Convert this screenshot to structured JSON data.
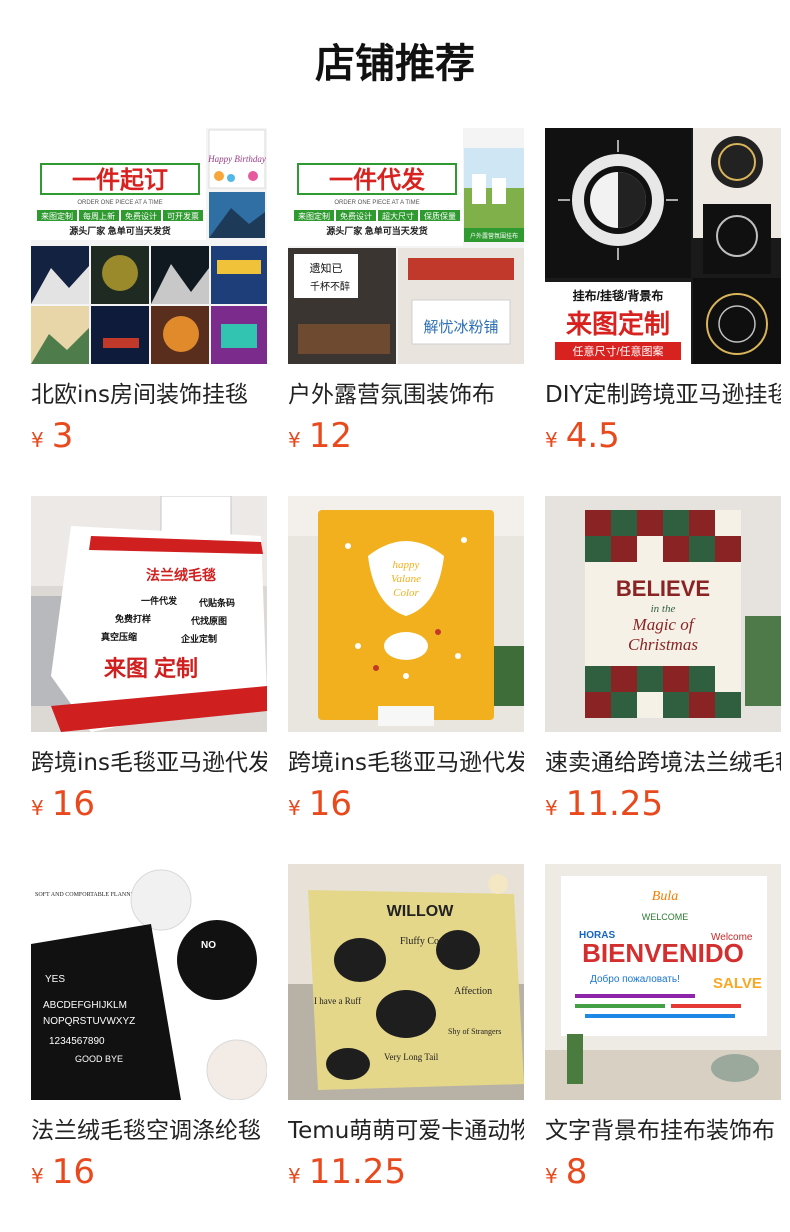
{
  "header": {
    "title": "店铺推荐"
  },
  "products": [
    {
      "name": "北欧ins房间装饰挂毯",
      "currency": "¥",
      "price": "3",
      "image": {
        "headline": "一件起订",
        "subline": "ORDER ONE PIECE AT A TIME",
        "tags": [
          "来图定制",
          "每周上新",
          "免费设计",
          "可开发票"
        ],
        "note": "源头厂家 急单可当天发货",
        "badge": "Happy Birthday"
      }
    },
    {
      "name": "户外露营氛围装饰布",
      "currency": "¥",
      "price": "12",
      "image": {
        "headline": "一件代发",
        "subline": "ORDER ONE PIECE AT A TIME",
        "tags": [
          "来图定制",
          "免费设计",
          "超大尺寸",
          "保质保量"
        ],
        "note": "源头厂家 急单可当天发货",
        "sign1": "遗知已",
        "sign2": "千杯不醉",
        "sign3": "解忧冰粉铺",
        "corner": "户外露营氛围挂布"
      }
    },
    {
      "name": "DIY定制跨境亚马逊挂毯",
      "currency": "¥",
      "price": "4.5",
      "image": {
        "line1": "挂布/挂毯/背景布",
        "line2": "来图定制",
        "line3": "任意尺寸/任意图案"
      }
    },
    {
      "name": "跨境ins毛毯亚马逊代发",
      "currency": "¥",
      "price": "16",
      "image": {
        "headline": "法兰绒毛毯",
        "features": [
          "一件代发",
          "代贴条码",
          "免费打样",
          "代找原图",
          "真空压缩",
          "企业定制"
        ],
        "cta": "来图 定制"
      }
    },
    {
      "name": "跨境ins毛毯亚马逊代发",
      "currency": "¥",
      "price": "16",
      "image": {
        "center1": "happy",
        "center2": "Valane",
        "center3": "Color"
      }
    },
    {
      "name": "速卖通给跨境法兰绒毛毯",
      "currency": "¥",
      "price": "11.25",
      "image": {
        "line1": "BELIEVE",
        "line2": "in the",
        "line3": "Magic of",
        "line4": "Christmas"
      }
    },
    {
      "name": "法兰绒毛毯空调涤纶毯",
      "currency": "¥",
      "price": "16",
      "image": {
        "top": "SOFT AND COMFORTABLE FLANNEL FLEECE",
        "letters": "ABCDEFGHIJKLM",
        "letters2": "NOPQRSTUVWXYZ",
        "numbers": "1234567890",
        "bye": "GOOD BYE",
        "yes": "YES",
        "no": "NO"
      }
    },
    {
      "name": "Temu萌萌可爱卡通动物毛毯",
      "currency": "¥",
      "price": "11.25",
      "image": {
        "top": "WILLOW",
        "t1": "Fluffy Coat",
        "t2": "I have a Ruff",
        "t3": "Affection",
        "t4": "Very Long Tail",
        "t5": "Shy of Strangers"
      }
    },
    {
      "name": "文字背景布挂布装饰布",
      "currency": "¥",
      "price": "8",
      "image": {
        "big": "BIENVENIDO",
        "w1": "WELCOME",
        "w2": "HORAS",
        "w3": "SALVE",
        "w4": "Добро пожаловать!",
        "w5": "Welcome",
        "w6": "Bula"
      }
    }
  ],
  "colors": {
    "price": "#e8491d",
    "title": "#111111",
    "text": "#222222"
  }
}
